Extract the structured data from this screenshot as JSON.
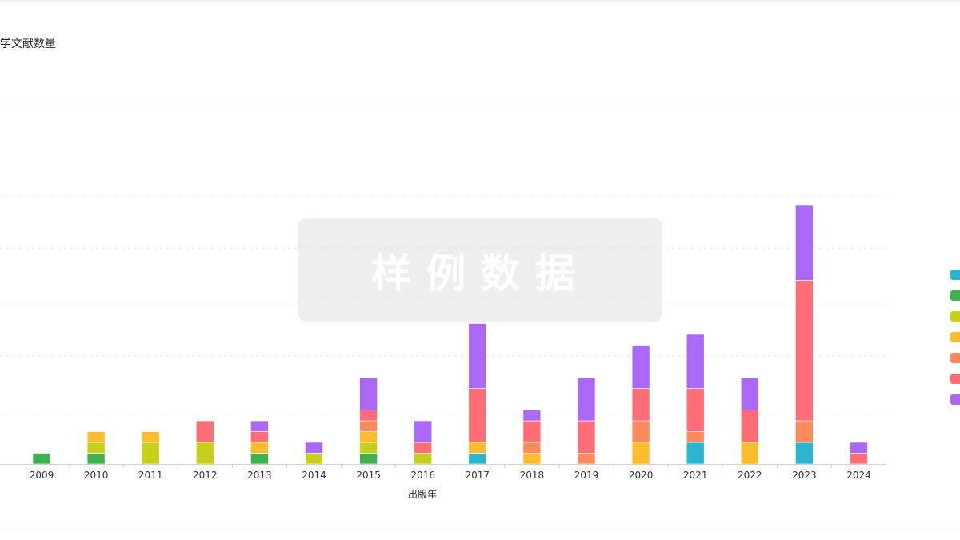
{
  "header": {
    "title": "学文献数量"
  },
  "watermark": {
    "text": "样例数据"
  },
  "legend_colors": [
    "#2bb5d0",
    "#3fb24f",
    "#c8cf1a",
    "#fbbd2d",
    "#fd8a5c",
    "#ff6e76",
    "#ab68f4"
  ],
  "chart_data": {
    "type": "bar",
    "stacked": true,
    "xlabel": "出版年",
    "ylabel": "",
    "ylim": [
      0,
      25
    ],
    "grid": true,
    "legend_position": "right",
    "categories": [
      "2009",
      "2010",
      "2011",
      "2012",
      "2013",
      "2014",
      "2015",
      "2016",
      "2017",
      "2018",
      "2019",
      "2020",
      "2021",
      "2022",
      "2023",
      "2024"
    ],
    "series": [
      {
        "color": "#2bb5d0",
        "values": [
          0,
          0,
          0,
          0,
          0,
          0,
          0,
          0,
          1,
          0,
          0,
          0,
          2,
          0,
          2,
          0
        ]
      },
      {
        "color": "#3fb24f",
        "values": [
          1,
          1,
          0,
          0,
          1,
          0,
          1,
          0,
          0,
          0,
          0,
          0,
          0,
          0,
          0,
          0
        ]
      },
      {
        "color": "#c8cf1a",
        "values": [
          0,
          1,
          2,
          2,
          0,
          1,
          1,
          1,
          0,
          0,
          0,
          0,
          0,
          0,
          0,
          0
        ]
      },
      {
        "color": "#fbbd2d",
        "values": [
          0,
          1,
          1,
          0,
          1,
          0,
          1,
          0,
          1,
          1,
          0,
          2,
          0,
          2,
          0,
          0
        ]
      },
      {
        "color": "#fd8a5c",
        "values": [
          0,
          0,
          0,
          0,
          0,
          0,
          1,
          0,
          0,
          1,
          1,
          2,
          1,
          0,
          2,
          0
        ]
      },
      {
        "color": "#ff6e76",
        "values": [
          0,
          0,
          0,
          2,
          1,
          0,
          1,
          1,
          5,
          2,
          3,
          3,
          4,
          3,
          13,
          1
        ]
      },
      {
        "color": "#ab68f4",
        "values": [
          0,
          0,
          0,
          0,
          1,
          1,
          3,
          2,
          6,
          1,
          4,
          4,
          5,
          3,
          7,
          1
        ]
      }
    ]
  }
}
